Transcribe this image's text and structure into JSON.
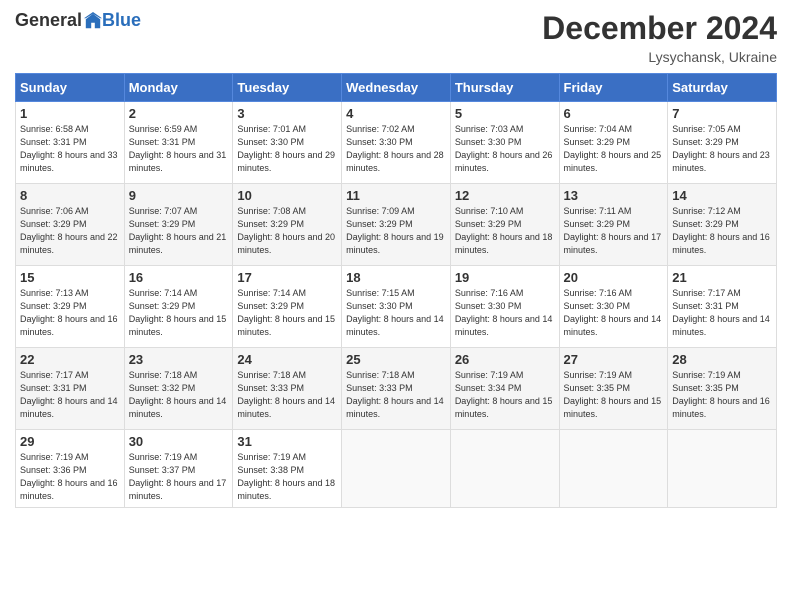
{
  "logo": {
    "general": "General",
    "blue": "Blue"
  },
  "title": "December 2024",
  "location": "Lysychansk, Ukraine",
  "days_header": [
    "Sunday",
    "Monday",
    "Tuesday",
    "Wednesday",
    "Thursday",
    "Friday",
    "Saturday"
  ],
  "weeks": [
    [
      {
        "day": "1",
        "sunrise": "6:58 AM",
        "sunset": "3:31 PM",
        "daylight": "8 hours and 33 minutes."
      },
      {
        "day": "2",
        "sunrise": "6:59 AM",
        "sunset": "3:31 PM",
        "daylight": "8 hours and 31 minutes."
      },
      {
        "day": "3",
        "sunrise": "7:01 AM",
        "sunset": "3:30 PM",
        "daylight": "8 hours and 29 minutes."
      },
      {
        "day": "4",
        "sunrise": "7:02 AM",
        "sunset": "3:30 PM",
        "daylight": "8 hours and 28 minutes."
      },
      {
        "day": "5",
        "sunrise": "7:03 AM",
        "sunset": "3:30 PM",
        "daylight": "8 hours and 26 minutes."
      },
      {
        "day": "6",
        "sunrise": "7:04 AM",
        "sunset": "3:29 PM",
        "daylight": "8 hours and 25 minutes."
      },
      {
        "day": "7",
        "sunrise": "7:05 AM",
        "sunset": "3:29 PM",
        "daylight": "8 hours and 23 minutes."
      }
    ],
    [
      {
        "day": "8",
        "sunrise": "7:06 AM",
        "sunset": "3:29 PM",
        "daylight": "8 hours and 22 minutes."
      },
      {
        "day": "9",
        "sunrise": "7:07 AM",
        "sunset": "3:29 PM",
        "daylight": "8 hours and 21 minutes."
      },
      {
        "day": "10",
        "sunrise": "7:08 AM",
        "sunset": "3:29 PM",
        "daylight": "8 hours and 20 minutes."
      },
      {
        "day": "11",
        "sunrise": "7:09 AM",
        "sunset": "3:29 PM",
        "daylight": "8 hours and 19 minutes."
      },
      {
        "day": "12",
        "sunrise": "7:10 AM",
        "sunset": "3:29 PM",
        "daylight": "8 hours and 18 minutes."
      },
      {
        "day": "13",
        "sunrise": "7:11 AM",
        "sunset": "3:29 PM",
        "daylight": "8 hours and 17 minutes."
      },
      {
        "day": "14",
        "sunrise": "7:12 AM",
        "sunset": "3:29 PM",
        "daylight": "8 hours and 16 minutes."
      }
    ],
    [
      {
        "day": "15",
        "sunrise": "7:13 AM",
        "sunset": "3:29 PM",
        "daylight": "8 hours and 16 minutes."
      },
      {
        "day": "16",
        "sunrise": "7:14 AM",
        "sunset": "3:29 PM",
        "daylight": "8 hours and 15 minutes."
      },
      {
        "day": "17",
        "sunrise": "7:14 AM",
        "sunset": "3:29 PM",
        "daylight": "8 hours and 15 minutes."
      },
      {
        "day": "18",
        "sunrise": "7:15 AM",
        "sunset": "3:30 PM",
        "daylight": "8 hours and 14 minutes."
      },
      {
        "day": "19",
        "sunrise": "7:16 AM",
        "sunset": "3:30 PM",
        "daylight": "8 hours and 14 minutes."
      },
      {
        "day": "20",
        "sunrise": "7:16 AM",
        "sunset": "3:30 PM",
        "daylight": "8 hours and 14 minutes."
      },
      {
        "day": "21",
        "sunrise": "7:17 AM",
        "sunset": "3:31 PM",
        "daylight": "8 hours and 14 minutes."
      }
    ],
    [
      {
        "day": "22",
        "sunrise": "7:17 AM",
        "sunset": "3:31 PM",
        "daylight": "8 hours and 14 minutes."
      },
      {
        "day": "23",
        "sunrise": "7:18 AM",
        "sunset": "3:32 PM",
        "daylight": "8 hours and 14 minutes."
      },
      {
        "day": "24",
        "sunrise": "7:18 AM",
        "sunset": "3:33 PM",
        "daylight": "8 hours and 14 minutes."
      },
      {
        "day": "25",
        "sunrise": "7:18 AM",
        "sunset": "3:33 PM",
        "daylight": "8 hours and 14 minutes."
      },
      {
        "day": "26",
        "sunrise": "7:19 AM",
        "sunset": "3:34 PM",
        "daylight": "8 hours and 15 minutes."
      },
      {
        "day": "27",
        "sunrise": "7:19 AM",
        "sunset": "3:35 PM",
        "daylight": "8 hours and 15 minutes."
      },
      {
        "day": "28",
        "sunrise": "7:19 AM",
        "sunset": "3:35 PM",
        "daylight": "8 hours and 16 minutes."
      }
    ],
    [
      {
        "day": "29",
        "sunrise": "7:19 AM",
        "sunset": "3:36 PM",
        "daylight": "8 hours and 16 minutes."
      },
      {
        "day": "30",
        "sunrise": "7:19 AM",
        "sunset": "3:37 PM",
        "daylight": "8 hours and 17 minutes."
      },
      {
        "day": "31",
        "sunrise": "7:19 AM",
        "sunset": "3:38 PM",
        "daylight": "8 hours and 18 minutes."
      },
      null,
      null,
      null,
      null
    ]
  ],
  "labels": {
    "sunrise": "Sunrise:",
    "sunset": "Sunset:",
    "daylight": "Daylight:"
  }
}
